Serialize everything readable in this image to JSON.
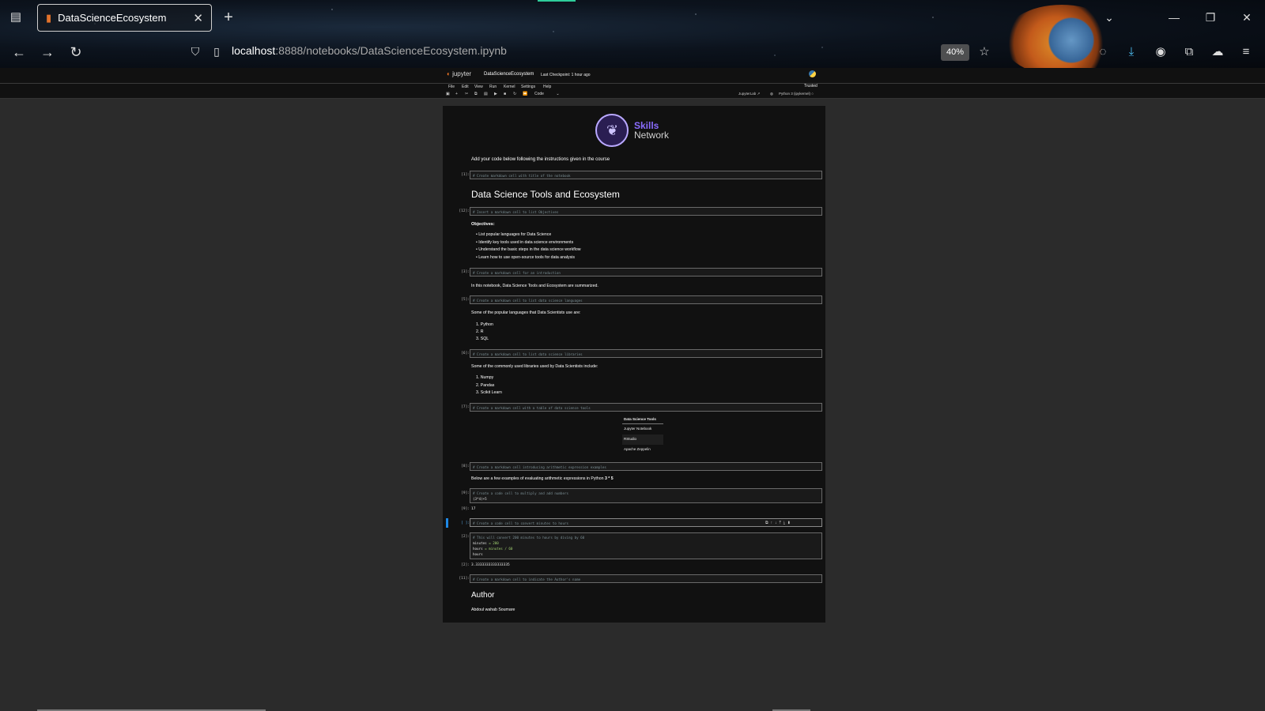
{
  "browser": {
    "tab_title": "DataScienceEcosystem",
    "url_host": "localhost",
    "url_rest": ":8888/notebooks/DataScienceEcosystem.ipynb",
    "zoom": "40%"
  },
  "jupyter": {
    "logo_text": "jupyter",
    "notebook_name": "DataScienceEcosystem",
    "checkpoint": "Last Checkpoint: 1 hour ago",
    "menu": [
      "File",
      "Edit",
      "View",
      "Run",
      "Kernel",
      "Settings",
      "Help"
    ],
    "trusted": "Trusted",
    "cell_type": "Code",
    "jupyterlab_link": "JupyterLab",
    "kernel": "Python 3 (ipykernel)"
  },
  "logo": {
    "skills": "Skills",
    "network": "Network"
  },
  "cells": {
    "intro_text": "Add your code below following the instructions given in the course",
    "c1_prompt": "[1]:",
    "c1_code": "# Create markdown cell with title of the notebook",
    "title": "Data Science Tools and Ecosystem",
    "c2_prompt": "[12]:",
    "c2_code": "# Insert a markdown cell to list Objectives",
    "objectives_label": "Objectives:",
    "objectives": [
      "List popular languages for Data Science",
      "Identify key tools used in data science environments",
      "Understand the basic steps in the data science workflow",
      "Learn how to use open-source tools for data analysis"
    ],
    "c3_prompt": "[3]:",
    "c3_code": "# Create a markdown cell for an introduction",
    "intro_summary": "In this notebook, Data Science Tools and Ecosystem are summarized.",
    "c4_prompt": "[5]:",
    "c4_code": "# Create a markdown cell to list data science languages",
    "languages_intro": "Some of the popular languages that Data Scientists use are:",
    "languages": [
      "1. Python",
      "2. R",
      "3. SQL"
    ],
    "c5_prompt": "[6]:",
    "c5_code": "# Create a markdown cell to list data science libraries",
    "libraries_intro": "Some of the commonly used libraries used by Data Scientists include:",
    "libraries": [
      "1. Numpy",
      "2. Pandas",
      "3. Scikit Learn"
    ],
    "c6_prompt": "[7]:",
    "c6_code": "# Create a markdown cell with a table of data science tools",
    "table_header": "Data Science Tools",
    "table_rows": [
      "Jupyter Notebook",
      "RStudio",
      "Apache Zeppelin"
    ],
    "c7_prompt": "[8]:",
    "c7_code": "# Create a markdown cell introducing arithmetic expression examples",
    "arith_intro": "Below are a few examples of evaluating arithmetic expressions in Python",
    "arith_expr": "3 * 5",
    "c8_prompt": "[9]:",
    "c8_code_comment": "# Create a code cell to multiply and add numbers",
    "c8_code": "(3*4)+5",
    "c8_out_prompt": "[9]:",
    "c8_out": "17",
    "c9_prompt": "[ ]:",
    "c9_code": "# Create a code cell to convert minutes to hours",
    "c10_prompt": "[2]:",
    "c10_comment": "# This will convert 200 minutes to hours by diving by 60",
    "c10_line1a": "minutes",
    "c10_line1b": "= 200",
    "c10_line2a": "hours",
    "c10_line2b": "= minutes / 60",
    "c10_line3": "hours",
    "c10_out_prompt": "[2]:",
    "c10_out": "3.3333333333333335",
    "c11_prompt": "[11]:",
    "c11_code": "#  Create a markdown cell to indicate the Author's name",
    "author_heading": "Author",
    "author_name": "Abdoul wahab Soumare"
  }
}
